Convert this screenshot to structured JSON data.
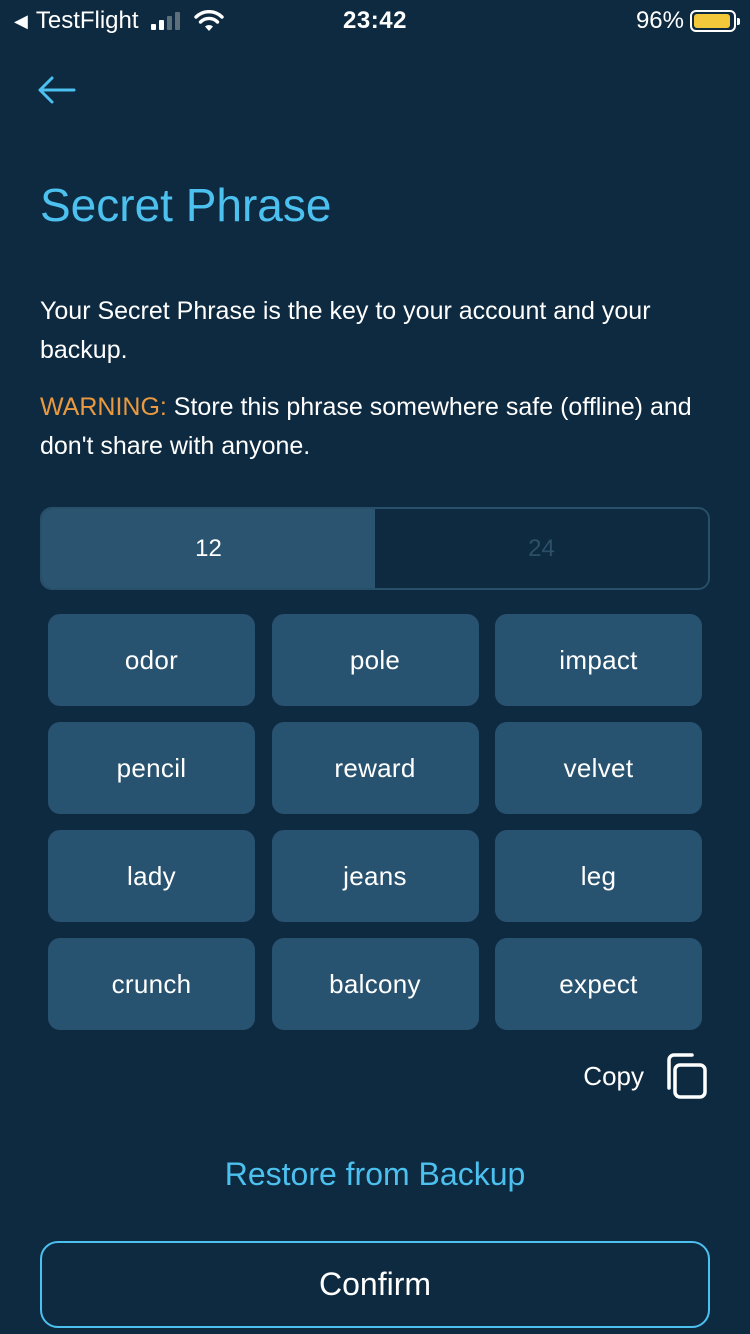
{
  "status_bar": {
    "carrier": "TestFlight",
    "time": "23:42",
    "battery_percent": "96%",
    "battery_level": 0.96,
    "signal_bars_filled": 2,
    "signal_bars_total": 4
  },
  "header": {
    "back_icon": "arrow-left-icon",
    "title": "Secret Phrase"
  },
  "description": "Your Secret Phrase is the key to your account and your backup.",
  "warning": {
    "label": "WARNING:",
    "text": " Store this phrase somewhere safe (offline) and don't share with anyone."
  },
  "word_count_toggle": {
    "options": [
      "12",
      "24"
    ],
    "selected": "12"
  },
  "words": [
    "odor",
    "pole",
    "impact",
    "pencil",
    "reward",
    "velvet",
    "lady",
    "jeans",
    "leg",
    "crunch",
    "balcony",
    "expect"
  ],
  "copy": {
    "label": "Copy",
    "icon": "copy-icon"
  },
  "restore_link": "Restore from Backup",
  "confirm_button": "Confirm",
  "colors": {
    "background": "#0e2a40",
    "accent": "#4cc0ef",
    "warning": "#e9993f",
    "tile": "#285370"
  }
}
